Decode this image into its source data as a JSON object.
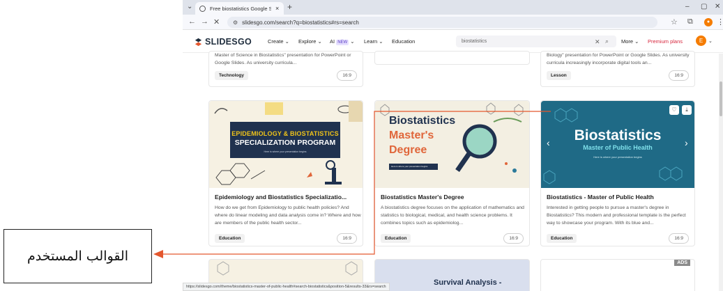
{
  "browser": {
    "tab_title": "Free biostatistics Google Slides",
    "tab_close": "×",
    "new_tab": "+",
    "url": "slidesgo.com/search?q=biostatistics#rs=search",
    "status_url": "https://slidesgo.com/theme/biostatistics-master-of-public-health#search-biostatistics&position-5&results-33&rs=search"
  },
  "site": {
    "logo": "SLIDESGO",
    "nav": {
      "create": "Create ⌄",
      "explore": "Explore ⌄",
      "ai": "AI",
      "ai_badge": "NEW",
      "learn": "Learn ⌄",
      "education": "Education"
    },
    "search_value": "biostatistics",
    "more": "More ⌄",
    "premium": "Premium plans",
    "avatar_letter": "E"
  },
  "top_cards": [
    {
      "desc": "Master of Science in Biostatistics\" presentation for PowerPoint or Google Slides. As university curricula...",
      "tag": "Technology",
      "ratio": "16:9"
    },
    {
      "desc": "",
      "tag": "",
      "ratio": ""
    },
    {
      "desc": "Biology\" presentation for PowerPoint or Google Slides. As university curricula increasingly incorporate digital tools an...",
      "tag": "Lesson",
      "ratio": "16:9"
    }
  ],
  "cards": [
    {
      "thumb_line1": "EPIDEMIOLOGY & BIOSTATISTICS",
      "thumb_line2": "SPECIALIZATION PROGRAM",
      "thumb_line3": "Here is where your presentation begins",
      "title": "Epidemiology and Biostatistics Specializatio...",
      "desc": "How do we get from Epidemiology to public health policies? And where do linear modeling and data analysis come in? Where and how are members of the public health sector...",
      "tag": "Education",
      "ratio": "16:9"
    },
    {
      "thumb_line1": "Biostatistics",
      "thumb_line2": "Master's",
      "thumb_line3": "Degree",
      "thumb_line4": "Here is where your presentation begins",
      "title": "Biostatistics Master's Degree",
      "desc": "A biostatistics degree focuses on the application of mathematics and statistics to biological, medical, and health science problems. It combines topics such as epidemiolog...",
      "tag": "Education",
      "ratio": "16:9"
    },
    {
      "thumb_line1": "Biostatistics",
      "thumb_line2": "Master of Public Health",
      "thumb_line3": "Here is where your presentation begins",
      "title": "Biostatistics - Master of Public Health",
      "desc": "Interested in getting people to pursue a master's degree in Biostatistics? This modern and professional template is the perfect way to showcase your program. With its blue and...",
      "tag": "Education",
      "ratio": "16:9"
    }
  ],
  "bottom_row": {
    "survival_title": "Survival Analysis -",
    "ads": "ADS"
  },
  "annotation": {
    "label": "القوالب المستخدم"
  },
  "colors": {
    "accent_orange": "#e4572e",
    "brand_navy": "#1f2d3d",
    "premium_red": "#d7263d"
  }
}
